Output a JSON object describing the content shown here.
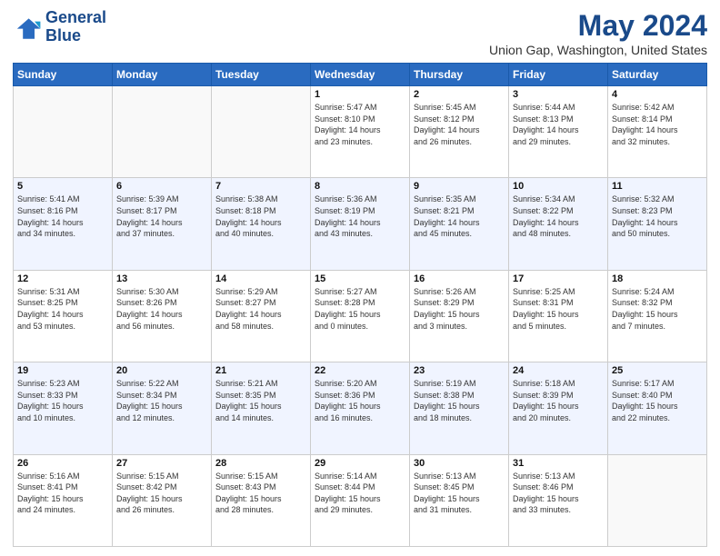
{
  "header": {
    "logo_line1": "General",
    "logo_line2": "Blue",
    "month_title": "May 2024",
    "location": "Union Gap, Washington, United States"
  },
  "weekdays": [
    "Sunday",
    "Monday",
    "Tuesday",
    "Wednesday",
    "Thursday",
    "Friday",
    "Saturday"
  ],
  "weeks": [
    [
      {
        "day": "",
        "info": ""
      },
      {
        "day": "",
        "info": ""
      },
      {
        "day": "",
        "info": ""
      },
      {
        "day": "1",
        "info": "Sunrise: 5:47 AM\nSunset: 8:10 PM\nDaylight: 14 hours\nand 23 minutes."
      },
      {
        "day": "2",
        "info": "Sunrise: 5:45 AM\nSunset: 8:12 PM\nDaylight: 14 hours\nand 26 minutes."
      },
      {
        "day": "3",
        "info": "Sunrise: 5:44 AM\nSunset: 8:13 PM\nDaylight: 14 hours\nand 29 minutes."
      },
      {
        "day": "4",
        "info": "Sunrise: 5:42 AM\nSunset: 8:14 PM\nDaylight: 14 hours\nand 32 minutes."
      }
    ],
    [
      {
        "day": "5",
        "info": "Sunrise: 5:41 AM\nSunset: 8:16 PM\nDaylight: 14 hours\nand 34 minutes."
      },
      {
        "day": "6",
        "info": "Sunrise: 5:39 AM\nSunset: 8:17 PM\nDaylight: 14 hours\nand 37 minutes."
      },
      {
        "day": "7",
        "info": "Sunrise: 5:38 AM\nSunset: 8:18 PM\nDaylight: 14 hours\nand 40 minutes."
      },
      {
        "day": "8",
        "info": "Sunrise: 5:36 AM\nSunset: 8:19 PM\nDaylight: 14 hours\nand 43 minutes."
      },
      {
        "day": "9",
        "info": "Sunrise: 5:35 AM\nSunset: 8:21 PM\nDaylight: 14 hours\nand 45 minutes."
      },
      {
        "day": "10",
        "info": "Sunrise: 5:34 AM\nSunset: 8:22 PM\nDaylight: 14 hours\nand 48 minutes."
      },
      {
        "day": "11",
        "info": "Sunrise: 5:32 AM\nSunset: 8:23 PM\nDaylight: 14 hours\nand 50 minutes."
      }
    ],
    [
      {
        "day": "12",
        "info": "Sunrise: 5:31 AM\nSunset: 8:25 PM\nDaylight: 14 hours\nand 53 minutes."
      },
      {
        "day": "13",
        "info": "Sunrise: 5:30 AM\nSunset: 8:26 PM\nDaylight: 14 hours\nand 56 minutes."
      },
      {
        "day": "14",
        "info": "Sunrise: 5:29 AM\nSunset: 8:27 PM\nDaylight: 14 hours\nand 58 minutes."
      },
      {
        "day": "15",
        "info": "Sunrise: 5:27 AM\nSunset: 8:28 PM\nDaylight: 15 hours\nand 0 minutes."
      },
      {
        "day": "16",
        "info": "Sunrise: 5:26 AM\nSunset: 8:29 PM\nDaylight: 15 hours\nand 3 minutes."
      },
      {
        "day": "17",
        "info": "Sunrise: 5:25 AM\nSunset: 8:31 PM\nDaylight: 15 hours\nand 5 minutes."
      },
      {
        "day": "18",
        "info": "Sunrise: 5:24 AM\nSunset: 8:32 PM\nDaylight: 15 hours\nand 7 minutes."
      }
    ],
    [
      {
        "day": "19",
        "info": "Sunrise: 5:23 AM\nSunset: 8:33 PM\nDaylight: 15 hours\nand 10 minutes."
      },
      {
        "day": "20",
        "info": "Sunrise: 5:22 AM\nSunset: 8:34 PM\nDaylight: 15 hours\nand 12 minutes."
      },
      {
        "day": "21",
        "info": "Sunrise: 5:21 AM\nSunset: 8:35 PM\nDaylight: 15 hours\nand 14 minutes."
      },
      {
        "day": "22",
        "info": "Sunrise: 5:20 AM\nSunset: 8:36 PM\nDaylight: 15 hours\nand 16 minutes."
      },
      {
        "day": "23",
        "info": "Sunrise: 5:19 AM\nSunset: 8:38 PM\nDaylight: 15 hours\nand 18 minutes."
      },
      {
        "day": "24",
        "info": "Sunrise: 5:18 AM\nSunset: 8:39 PM\nDaylight: 15 hours\nand 20 minutes."
      },
      {
        "day": "25",
        "info": "Sunrise: 5:17 AM\nSunset: 8:40 PM\nDaylight: 15 hours\nand 22 minutes."
      }
    ],
    [
      {
        "day": "26",
        "info": "Sunrise: 5:16 AM\nSunset: 8:41 PM\nDaylight: 15 hours\nand 24 minutes."
      },
      {
        "day": "27",
        "info": "Sunrise: 5:15 AM\nSunset: 8:42 PM\nDaylight: 15 hours\nand 26 minutes."
      },
      {
        "day": "28",
        "info": "Sunrise: 5:15 AM\nSunset: 8:43 PM\nDaylight: 15 hours\nand 28 minutes."
      },
      {
        "day": "29",
        "info": "Sunrise: 5:14 AM\nSunset: 8:44 PM\nDaylight: 15 hours\nand 29 minutes."
      },
      {
        "day": "30",
        "info": "Sunrise: 5:13 AM\nSunset: 8:45 PM\nDaylight: 15 hours\nand 31 minutes."
      },
      {
        "day": "31",
        "info": "Sunrise: 5:13 AM\nSunset: 8:46 PM\nDaylight: 15 hours\nand 33 minutes."
      },
      {
        "day": "",
        "info": ""
      }
    ]
  ]
}
